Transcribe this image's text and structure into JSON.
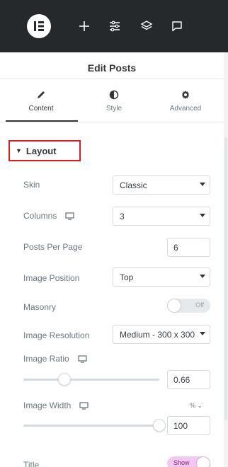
{
  "topbar": {
    "logo": "elementor-logo",
    "buttons": [
      {
        "name": "add-element-icon"
      },
      {
        "name": "site-settings-icon"
      },
      {
        "name": "structure-layers-icon"
      },
      {
        "name": "comments-icon"
      }
    ],
    "background": "#26292c"
  },
  "header": {
    "title": "Edit Posts"
  },
  "tabs": [
    {
      "label": "Content",
      "icon": "pencil-icon",
      "active": true
    },
    {
      "label": "Style",
      "icon": "half-circle-icon",
      "active": false
    },
    {
      "label": "Advanced",
      "icon": "gear-icon",
      "active": false
    }
  ],
  "section": {
    "title": "Layout",
    "highlight_color": "#d91f26"
  },
  "controls": {
    "skin": {
      "label": "Skin",
      "value": "Classic"
    },
    "columns": {
      "label": "Columns",
      "value": "3",
      "responsive_icon": "desktop-icon"
    },
    "posts_per_page": {
      "label": "Posts Per Page",
      "value": "6"
    },
    "image_position": {
      "label": "Image Position",
      "value": "Top"
    },
    "masonry": {
      "label": "Masonry",
      "state": "Off"
    },
    "image_resolution": {
      "label": "Image Resolution",
      "value": "Medium - 300 x 300"
    },
    "image_ratio": {
      "label": "Image Ratio",
      "value": "0.66",
      "slider_fraction": 0.3,
      "responsive_icon": "desktop-icon"
    },
    "image_width": {
      "label": "Image Width",
      "value": "100",
      "unit": "%",
      "slider_fraction": 1.0,
      "responsive_icon": "desktop-icon"
    },
    "title": {
      "label": "Title",
      "state": "Show",
      "accent": "#f4c6f1"
    }
  }
}
